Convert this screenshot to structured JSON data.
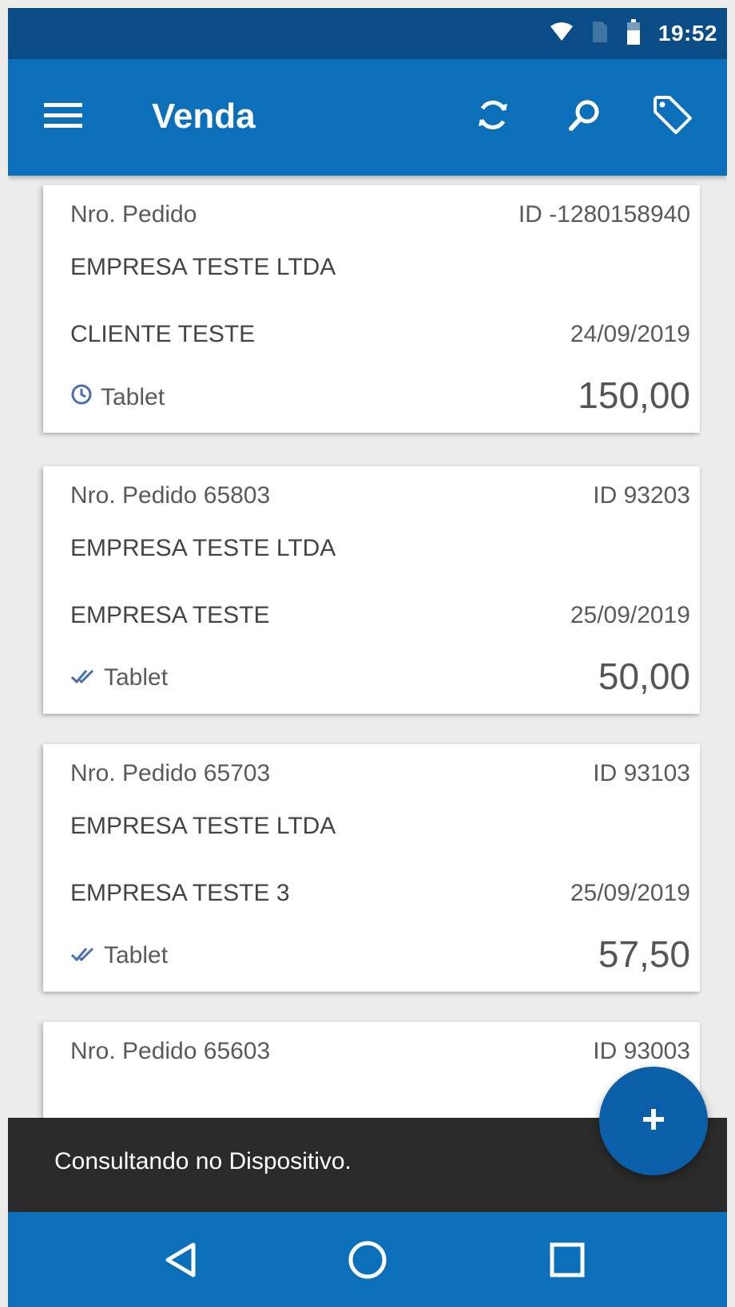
{
  "status_bar": {
    "time": "19:52",
    "icons": [
      "wifi-icon",
      "sim-icon",
      "battery-icon"
    ]
  },
  "app_bar": {
    "title": "Venda",
    "actions": [
      "sync-icon",
      "search-icon",
      "tag-icon"
    ],
    "menu_icon": "menu-icon"
  },
  "orders": [
    {
      "order_label": "Nro. Pedido",
      "id": "ID -1280158940",
      "company": "EMPRESA TESTE LTDA",
      "client": "CLIENTE TESTE",
      "date": "24/09/2019",
      "status_icon": "clock-icon",
      "origin": "Tablet",
      "total": "150,00"
    },
    {
      "order_label": "Nro. Pedido 65803",
      "id": "ID 93203",
      "company": "EMPRESA TESTE LTDA",
      "client": "EMPRESA TESTE",
      "date": "25/09/2019",
      "status_icon": "double-check-icon",
      "origin": "Tablet",
      "total": "50,00"
    },
    {
      "order_label": "Nro. Pedido 65703",
      "id": "ID 93103",
      "company": "EMPRESA TESTE LTDA",
      "client": "EMPRESA TESTE 3",
      "date": "25/09/2019",
      "status_icon": "double-check-icon",
      "origin": "Tablet",
      "total": "57,50"
    },
    {
      "order_label": "Nro. Pedido 65603",
      "id": "ID 93003"
    }
  ],
  "snackbar": {
    "text": "Consultando no Dispositivo."
  },
  "fab": {
    "icon": "plus-icon",
    "label": "+"
  },
  "nav_bar": {
    "buttons": [
      "back-icon",
      "home-icon",
      "recents-icon"
    ]
  },
  "colors": {
    "status_bar": "#0a4d86",
    "app_bar": "#0b70b9",
    "fab": "#0b5fa8",
    "snackbar": "#2a2a2a",
    "background": "#ececec",
    "check_icon": "#4a6fb0"
  }
}
